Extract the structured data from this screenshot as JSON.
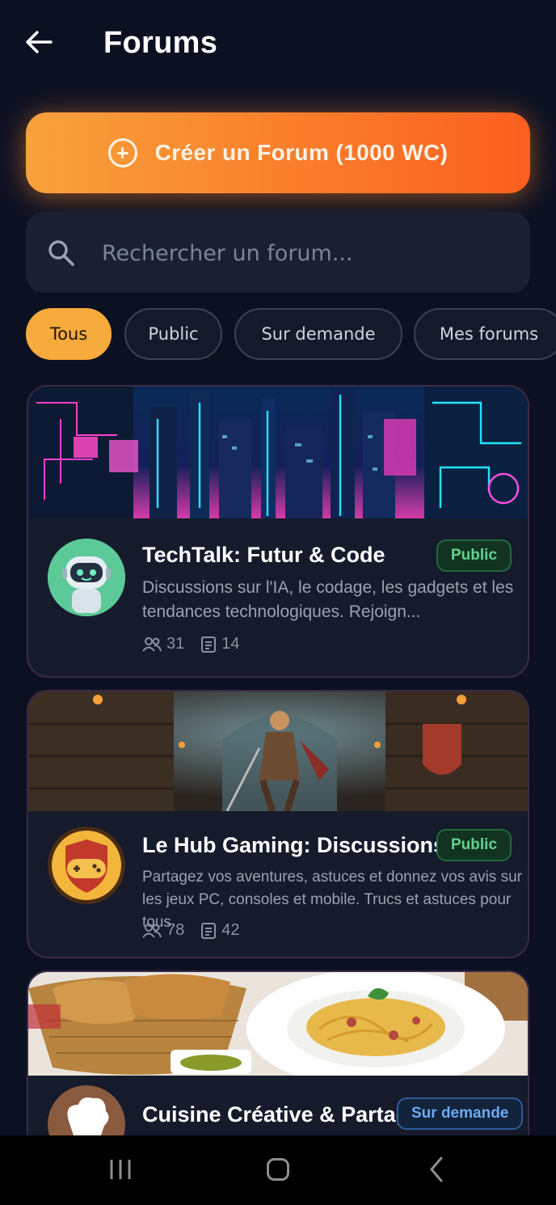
{
  "header": {
    "title": "Forums"
  },
  "create_button": {
    "label": "Créer un Forum (1000 WC)"
  },
  "search": {
    "placeholder": "Rechercher un forum..."
  },
  "filters": [
    "Tous",
    "Public",
    "Sur demande",
    "Mes forums"
  ],
  "active_filter": "Tous",
  "forums": [
    {
      "title": "TechTalk: Futur & Code",
      "badge": "Public",
      "description": "Discussions sur l'IA, le codage, les gadgets et les tendances technologiques. Rejoign...",
      "members": "31",
      "posts": "14",
      "banner": "cyberpunk-city",
      "avatar": "robot-avatar"
    },
    {
      "title": "Le Hub Gaming: Discussions",
      "badge": "Public",
      "description": "Partagez vos aventures, astuces et donnez vos avis sur les jeux PC, consoles et mobile. Trucs et astuces pour tous.",
      "members": "78",
      "posts": "42",
      "banner": "fantasy-warrior-dungeon",
      "avatar": "gamepad-shield-avatar"
    },
    {
      "title": "Cuisine Créative & Partage",
      "badge": "Sur demande",
      "banner": "bread-and-pasta",
      "avatar": "chef-hat-avatar"
    }
  ],
  "colors": {
    "background": "#0c1122",
    "accent_orange": "#fa7d2a",
    "chip_active": "#f8ab3d",
    "badge_public": "#5fd48a",
    "badge_request": "#6ea9f0"
  },
  "icons": {
    "back": "arrow-left-icon",
    "create": "plus-circle-icon",
    "search": "search-icon",
    "members": "users-icon",
    "posts": "document-icon",
    "nav_recents": "recents-icon",
    "nav_home": "home-icon",
    "nav_back": "back-chevron-icon"
  }
}
